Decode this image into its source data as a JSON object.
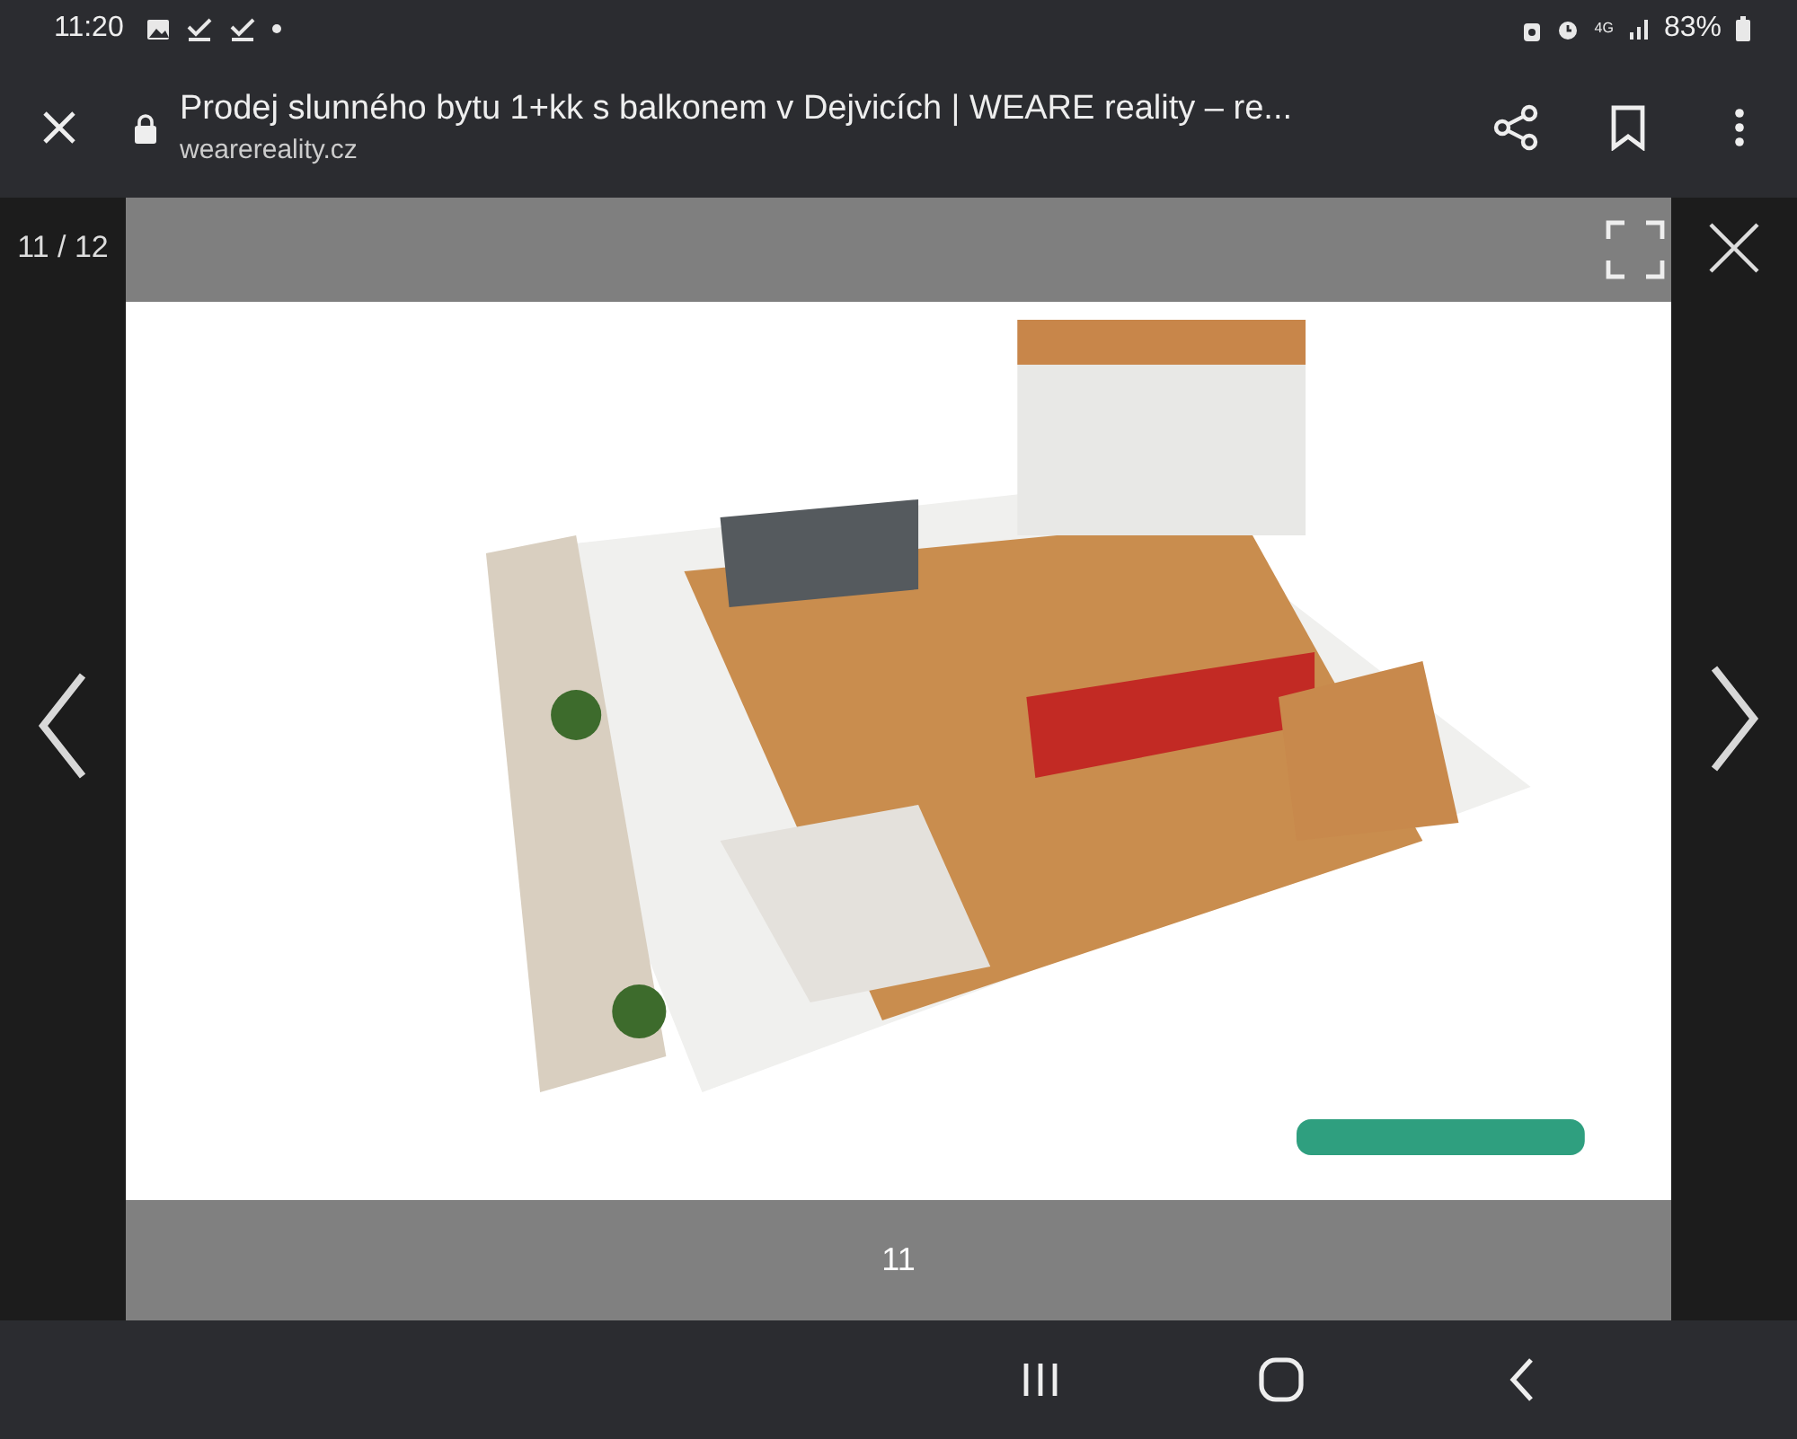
{
  "status_bar": {
    "time": "11:20",
    "battery": "83%",
    "network": "4G"
  },
  "browser_toolbar": {
    "title": "Prodej slunného bytu 1+kk s balkonem v Dejvicích | WEARE reality – re...",
    "url": "wearereality.cz"
  },
  "gallery": {
    "counter": "11 / 12",
    "caption": "11"
  }
}
